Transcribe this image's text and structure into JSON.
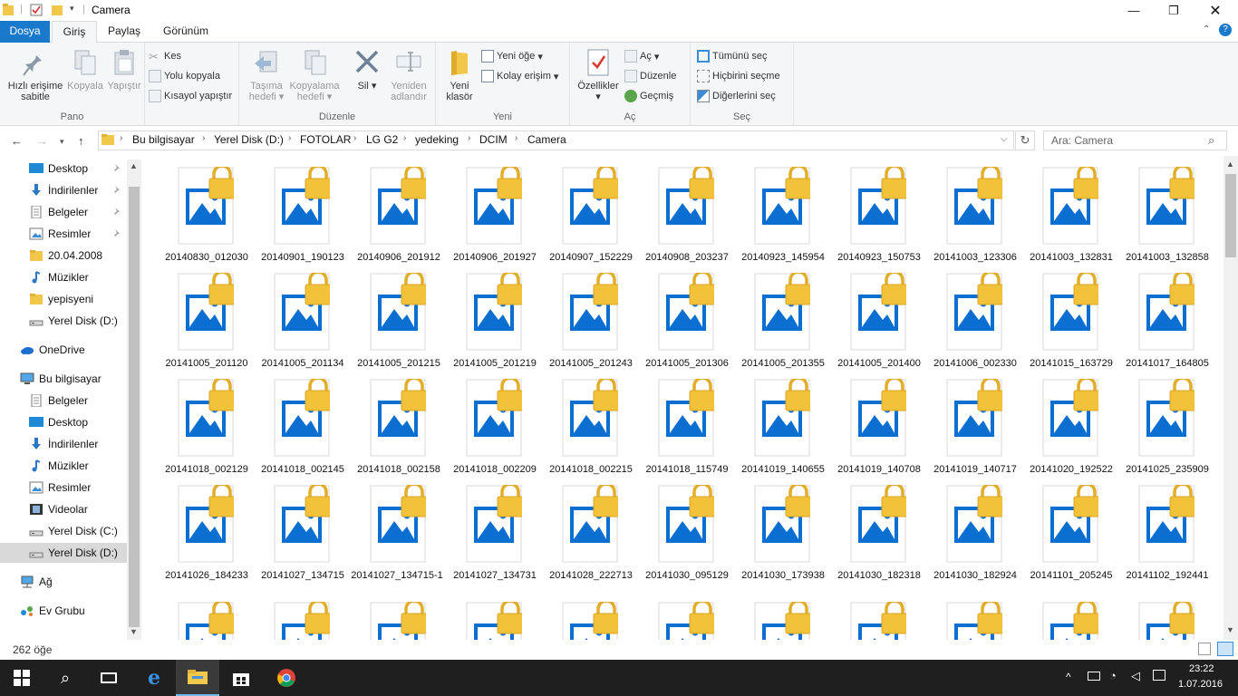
{
  "window": {
    "title": "Camera"
  },
  "ribbon": {
    "tabs": [
      "Dosya",
      "Giriş",
      "Paylaş",
      "Görünüm"
    ],
    "pano": {
      "label": "Pano",
      "pin": "Hızlı erişime sabitle",
      "copy": "Kopyala",
      "paste": "Yapıştır",
      "cut": "Kes",
      "copy_path": "Yolu kopyala",
      "paste_shortcut": "Kısayol yapıştır"
    },
    "duzenle": {
      "label": "Düzenle",
      "move_to": "Taşıma hedefi",
      "copy_to": "Kopyalama hedefi",
      "delete": "Sil",
      "rename": "Yeniden adlandır"
    },
    "yeni": {
      "label": "Yeni",
      "new_folder": "Yeni klasör",
      "new_item": "Yeni öğe",
      "easy_access": "Kolay erişim"
    },
    "ac": {
      "label": "Aç",
      "properties": "Özellikler",
      "open": "Aç",
      "edit": "Düzenle",
      "history": "Geçmiş"
    },
    "sec": {
      "label": "Seç",
      "select_all": "Tümünü seç",
      "select_none": "Hiçbirini seçme",
      "invert": "Diğerlerini seç"
    }
  },
  "address": {
    "crumbs": [
      "Bu bilgisayar",
      "Yerel Disk (D:)",
      "FOTOLAR",
      "LG G2",
      "yedeking",
      "DCIM",
      "Camera"
    ],
    "search_placeholder": "Ara: Camera"
  },
  "nav": [
    {
      "label": "Desktop",
      "icon": "desktop-icon",
      "pinned": true
    },
    {
      "label": "İndirilenler",
      "icon": "download-icon",
      "pinned": true
    },
    {
      "label": "Belgeler",
      "icon": "documents-icon",
      "pinned": true
    },
    {
      "label": "Resimler",
      "icon": "pictures-icon",
      "pinned": true
    },
    {
      "label": "20.04.2008",
      "icon": "folder-icon",
      "pinned": false
    },
    {
      "label": "Müzikler",
      "icon": "music-icon",
      "pinned": false
    },
    {
      "label": "yepisyeni",
      "icon": "folder-icon",
      "pinned": false
    },
    {
      "label": "Yerel Disk (D:)",
      "icon": "drive-icon",
      "pinned": false
    },
    {
      "label": "OneDrive",
      "icon": "onedrive-icon",
      "pinned": false
    },
    {
      "label": "Bu bilgisayar",
      "icon": "computer-icon",
      "pinned": false
    },
    {
      "label": "Belgeler",
      "icon": "documents-icon",
      "pinned": false
    },
    {
      "label": "Desktop",
      "icon": "desktop-icon",
      "pinned": false
    },
    {
      "label": "İndirilenler",
      "icon": "download-icon",
      "pinned": false
    },
    {
      "label": "Müzikler",
      "icon": "music-icon",
      "pinned": false
    },
    {
      "label": "Resimler",
      "icon": "pictures-icon",
      "pinned": false
    },
    {
      "label": "Videolar",
      "icon": "video-icon",
      "pinned": false
    },
    {
      "label": "Yerel Disk (C:)",
      "icon": "drive-icon",
      "pinned": false
    },
    {
      "label": "Yerel Disk (D:)",
      "icon": "drive-icon",
      "pinned": false,
      "selected": true
    },
    {
      "label": "Ağ",
      "icon": "network-icon",
      "pinned": false
    },
    {
      "label": "Ev Grubu",
      "icon": "homegroup-icon",
      "pinned": false
    }
  ],
  "files": [
    "20140830_012030",
    "20140901_190123",
    "20140906_201912",
    "20140906_201927",
    "20140907_152229",
    "20140908_203237",
    "20140923_145954",
    "20140923_150753",
    "20141003_123306",
    "20141003_132831",
    "20141003_132858",
    "20141005_201120",
    "20141005_201134",
    "20141005_201215",
    "20141005_201219",
    "20141005_201243",
    "20141005_201306",
    "20141005_201355",
    "20141005_201400",
    "20141006_002330",
    "20141015_163729",
    "20141017_164805",
    "20141018_002129",
    "20141018_002145",
    "20141018_002158",
    "20141018_002209",
    "20141018_002215",
    "20141018_115749",
    "20141019_140655",
    "20141019_140708",
    "20141019_140717",
    "20141020_192522",
    "20141025_235909",
    "20141026_184233",
    "20141027_134715",
    "20141027_134715-1",
    "20141027_134731",
    "20141028_222713",
    "20141030_095129",
    "20141030_173938",
    "20141030_182318",
    "20141030_182924",
    "20141101_205245",
    "20141102_192441",
    "",
    "",
    "",
    "",
    "",
    "",
    "",
    "",
    "",
    "",
    ""
  ],
  "status": {
    "count": "262 öğe"
  },
  "taskbar": {
    "time": "23:22",
    "date": "1.07.2016"
  },
  "colors": {
    "accent": "#1979ca",
    "lock": "#f2c23a",
    "image_blue": "#0a6fd0"
  }
}
